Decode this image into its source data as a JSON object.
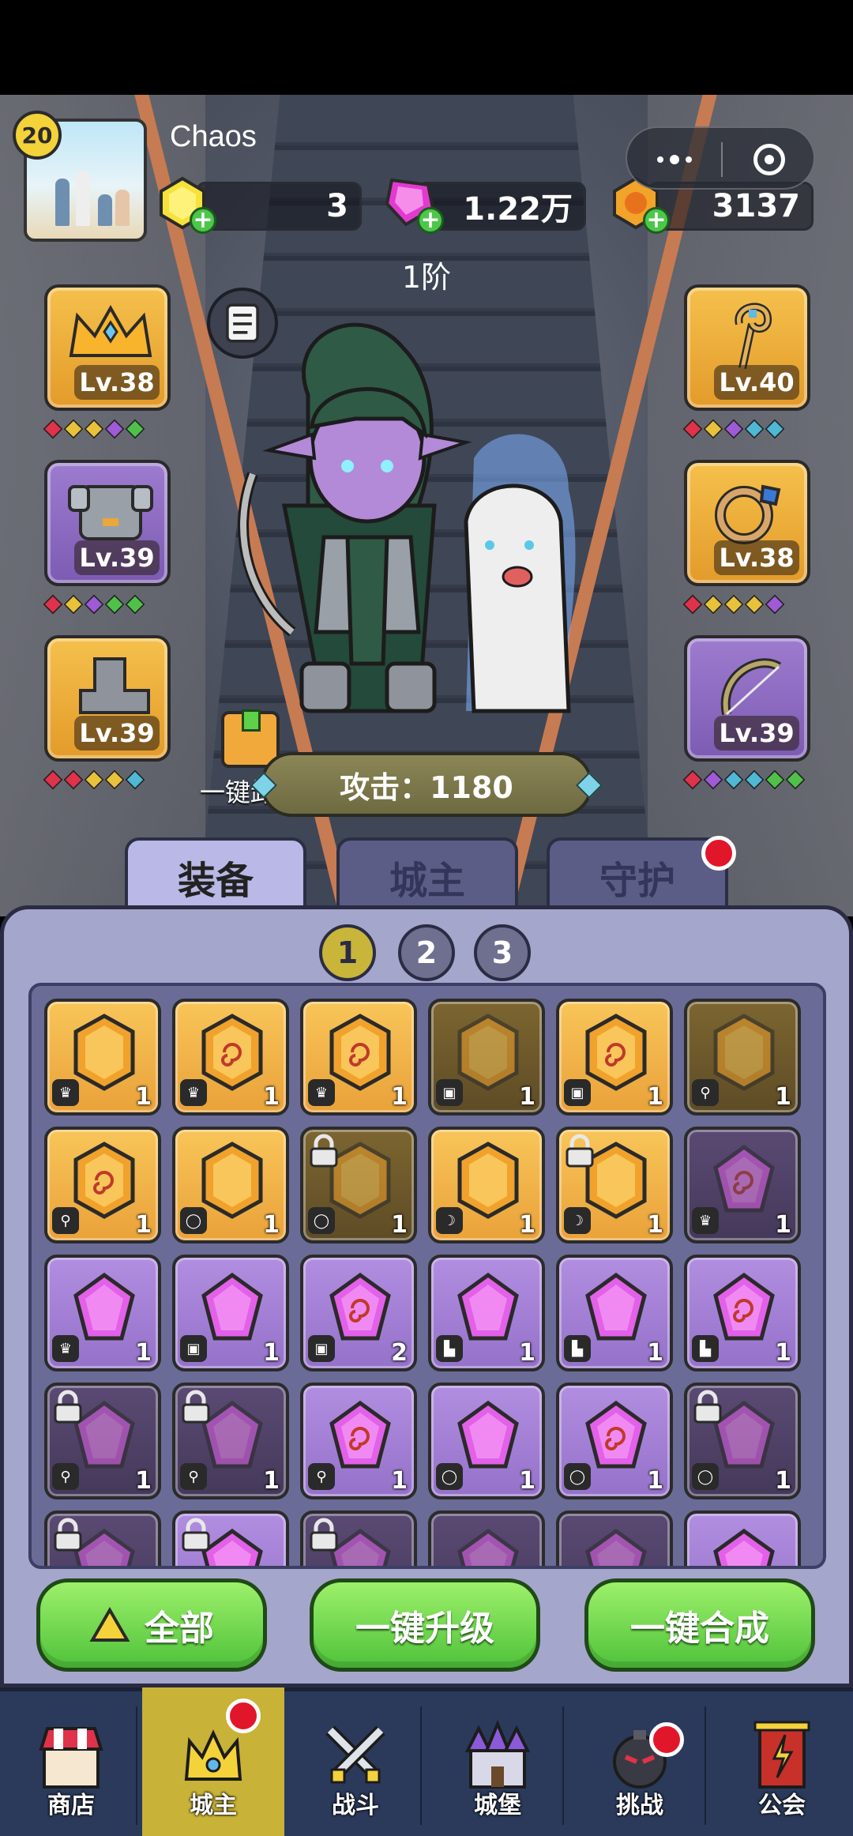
{
  "player": {
    "name": "Chaos",
    "level": "20"
  },
  "resources": {
    "yellow_gem": "3",
    "pink_gem": "1.22万",
    "gold_coin": "3137"
  },
  "tier": "1阶",
  "slots_left": [
    {
      "level": "Lv.38",
      "icon": "crown-icon"
    },
    {
      "level": "Lv.39",
      "icon": "armor-icon"
    },
    {
      "level": "Lv.39",
      "icon": "boot-icon"
    }
  ],
  "slots_right": [
    {
      "level": "Lv.40",
      "icon": "staff-icon"
    },
    {
      "level": "Lv.38",
      "icon": "ring-icon"
    },
    {
      "level": "Lv.39",
      "icon": "bow-icon"
    }
  ],
  "unequip_label": "一键卸装",
  "attack_label": "攻击：1180",
  "tabs": [
    "装备",
    "城主",
    "守护"
  ],
  "pages": [
    "1",
    "2",
    "3"
  ],
  "grid": [
    [
      {
        "t": "g",
        "c": "1",
        "s": "crown",
        "sp": false
      },
      {
        "t": "g",
        "c": "1",
        "s": "crown",
        "sp": true
      },
      {
        "t": "g",
        "c": "1",
        "s": "crown",
        "sp": true
      },
      {
        "t": "gd",
        "c": "1",
        "s": "armor",
        "sp": false
      },
      {
        "t": "g",
        "c": "1",
        "s": "armor",
        "sp": true
      },
      {
        "t": "gd",
        "c": "1",
        "s": "staff",
        "sp": false
      }
    ],
    [
      {
        "t": "g",
        "c": "1",
        "s": "staff",
        "sp": true
      },
      {
        "t": "g",
        "c": "1",
        "s": "ring",
        "sp": false
      },
      {
        "t": "gd",
        "c": "1",
        "s": "ring",
        "sp": false,
        "lock": true
      },
      {
        "t": "g",
        "c": "1",
        "s": "bow",
        "sp": false
      },
      {
        "t": "g",
        "c": "1",
        "s": "bow",
        "sp": false,
        "lock": true
      },
      {
        "t": "pd",
        "c": "1",
        "s": "crown",
        "sp": true
      }
    ],
    [
      {
        "t": "p",
        "c": "1",
        "s": "crown",
        "sp": false
      },
      {
        "t": "p",
        "c": "1",
        "s": "armor",
        "sp": false
      },
      {
        "t": "p",
        "c": "2",
        "s": "armor",
        "sp": true
      },
      {
        "t": "p",
        "c": "1",
        "s": "boot",
        "sp": false
      },
      {
        "t": "p",
        "c": "1",
        "s": "boot",
        "sp": false
      },
      {
        "t": "p",
        "c": "1",
        "s": "boot",
        "sp": true
      }
    ],
    [
      {
        "t": "pd",
        "c": "1",
        "s": "staff",
        "sp": false,
        "lock": true
      },
      {
        "t": "pd",
        "c": "1",
        "s": "staff",
        "sp": false,
        "lock": true
      },
      {
        "t": "p",
        "c": "1",
        "s": "staff",
        "sp": true
      },
      {
        "t": "p",
        "c": "1",
        "s": "ring",
        "sp": false
      },
      {
        "t": "p",
        "c": "1",
        "s": "ring",
        "sp": true
      },
      {
        "t": "pd",
        "c": "1",
        "s": "ring",
        "sp": false,
        "lock": true
      }
    ],
    [
      {
        "t": "pd",
        "c": "",
        "s": "",
        "sp": false,
        "lock": true
      },
      {
        "t": "p",
        "c": "",
        "s": "",
        "sp": false,
        "lock": true
      },
      {
        "t": "pd",
        "c": "",
        "s": "",
        "sp": false,
        "lock": true
      },
      {
        "t": "pd",
        "c": "",
        "s": "",
        "sp": false
      },
      {
        "t": "pd",
        "c": "",
        "s": "",
        "sp": false
      },
      {
        "t": "p",
        "c": "",
        "s": "",
        "sp": false
      }
    ]
  ],
  "buttons": {
    "all": "全部",
    "upgrade": "一键升级",
    "merge": "一键合成"
  },
  "nav": [
    "商店",
    "城主",
    "战斗",
    "城堡",
    "挑战",
    "公会"
  ],
  "colors": {
    "gold_slot": "#f5c04c",
    "purple_slot": "#9d7ccf",
    "green_button": "#4fc23a",
    "red_dot": "#e2162a"
  }
}
